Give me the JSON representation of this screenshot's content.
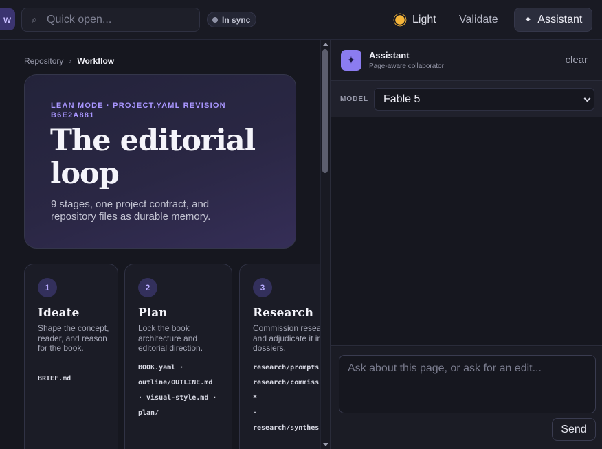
{
  "topbar": {
    "nav_stub_label": "w",
    "search_placeholder": "Quick open...",
    "sync_status": "In sync",
    "theme_label": "Light",
    "validate_label": "Validate",
    "assistant_label": "Assistant"
  },
  "breadcrumb": {
    "root": "Repository",
    "separator": "›",
    "current": "Workflow"
  },
  "hero": {
    "eyebrow": "LEAN MODE · PROJECT.YAML REVISION B6E2A881",
    "title": "The editorial loop",
    "subtitle": "9 stages, one project contract, and repository files as durable memory."
  },
  "stages": [
    {
      "number": "1",
      "name": "Ideate",
      "description": "Shape the concept, reader, and reason for the book.",
      "files": [
        "BRIEF.md"
      ]
    },
    {
      "number": "2",
      "name": "Plan",
      "description": "Lock the book architecture and editorial direction.",
      "files": [
        "BOOK.yaml ·",
        "outline/OUTLINE.md",
        "· visual-style.md ·",
        "plan/"
      ]
    },
    {
      "number": "3",
      "name": "Research",
      "description": "Commission research and adjudicate it into dossiers.",
      "files": [
        "research/prompts",
        "research/commissions/",
        "*",
        "·",
        "research/synthesis"
      ]
    }
  ],
  "assistant_panel": {
    "title": "Assistant",
    "subtitle": "Page-aware collaborator",
    "clear_label": "clear",
    "model_label": "MODEL",
    "model_value": "Fable 5",
    "input_placeholder": "Ask about this page, or ask for an edit...",
    "send_label": "Send"
  },
  "colors": {
    "accent": "#8b7cf0",
    "eyebrow": "#a996ff",
    "background": "#16171f",
    "sun": "#f5b53a"
  },
  "icons": {
    "search": "search-icon",
    "sync": "status-dot-icon",
    "theme": "sun-icon",
    "assistant": "sparkle-icon",
    "select": "chevron-down-icon"
  }
}
